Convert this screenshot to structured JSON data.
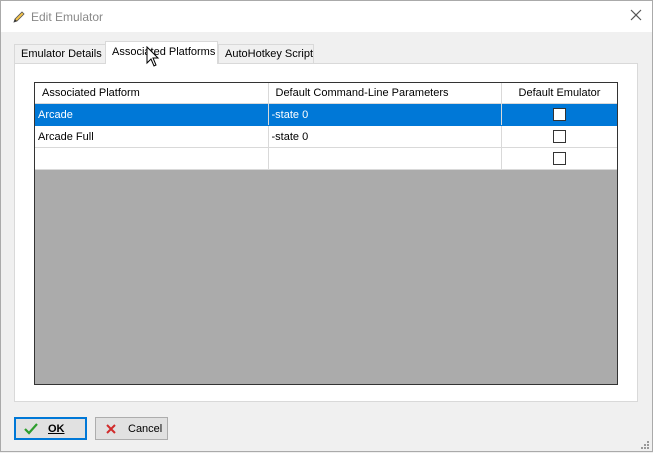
{
  "window": {
    "title": "Edit Emulator"
  },
  "tabs": [
    {
      "label": "Emulator Details",
      "active": false
    },
    {
      "label": "Associated Platforms",
      "active": true
    },
    {
      "label": "AutoHotkey Script",
      "active": false
    }
  ],
  "grid": {
    "columns": [
      "Associated Platform",
      "Default Command-Line Parameters",
      "Default Emulator"
    ],
    "rows": [
      {
        "platform": "Arcade",
        "params": "-state 0",
        "default": false,
        "selected": true
      },
      {
        "platform": "Arcade Full",
        "params": "-state 0",
        "default": false,
        "selected": false
      },
      {
        "platform": "",
        "params": "",
        "default": false,
        "selected": false
      }
    ]
  },
  "buttons": {
    "ok": "OK",
    "cancel": "Cancel"
  },
  "colors": {
    "selection": "#0078d7",
    "grid_empty": "#ababab",
    "ok_check": "#2e9e2e",
    "cancel_x": "#d12c2c"
  }
}
